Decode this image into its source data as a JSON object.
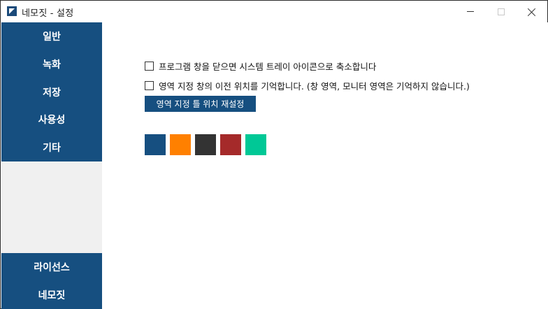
{
  "window": {
    "title": "네모짓 - 설정"
  },
  "sidebar": {
    "top_items": [
      {
        "label": "일반"
      },
      {
        "label": "녹화"
      },
      {
        "label": "저장"
      },
      {
        "label": "사용성"
      },
      {
        "label": "기타"
      }
    ],
    "bottom_items": [
      {
        "label": "라이선스"
      },
      {
        "label": "네모짓"
      }
    ],
    "accent_color": "#164f80",
    "background_color": "#f0f0f0"
  },
  "settings": {
    "minimize_to_tray": {
      "label": "프로그램 창을 닫으면 시스템 트레이 아이콘으로 축소합니다",
      "checked": false
    },
    "remember_position": {
      "label": "영역 지정 창의 이전 위치를 기억합니다. (창 영역, 모니터 영역은 기억하지 않습니다.)",
      "checked": false
    },
    "reset_button_label": "영역 지정 틀 위치 재설정",
    "color_swatches": [
      {
        "name": "navy",
        "color": "#164f80"
      },
      {
        "name": "orange",
        "color": "#ff8000"
      },
      {
        "name": "dark-gray",
        "color": "#333333"
      },
      {
        "name": "red",
        "color": "#a52a2a"
      },
      {
        "name": "teal",
        "color": "#00c896"
      }
    ]
  }
}
